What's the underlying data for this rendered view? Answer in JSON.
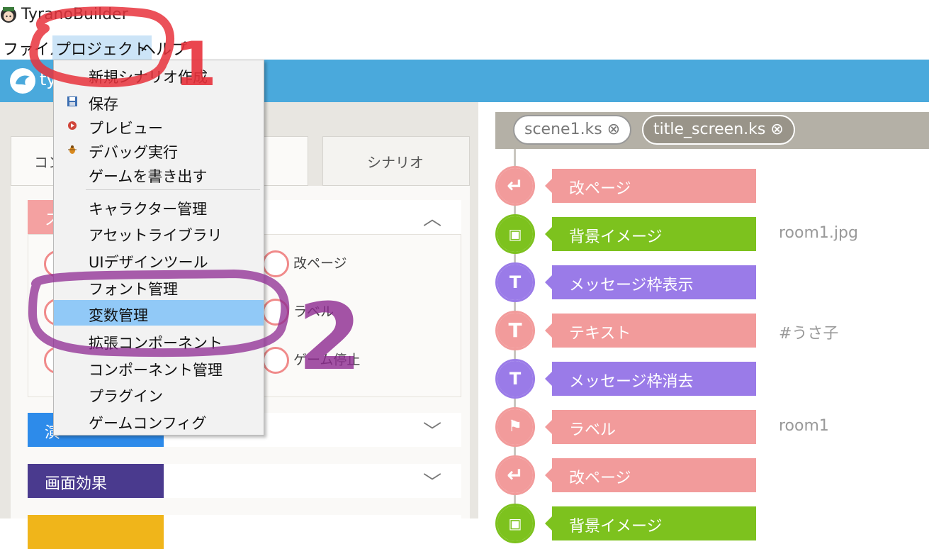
{
  "app": {
    "title": "TyranoBuilder",
    "logo_text": "ty"
  },
  "menubar": {
    "file": "ファイル",
    "project": "プロジェクト",
    "help": "ヘルプ"
  },
  "dropdown": {
    "items": [
      {
        "label": "新規シナリオ作成",
        "icon": ""
      },
      {
        "label": "保存",
        "icon": "floppy-icon"
      },
      {
        "label": "プレビュー",
        "icon": "play-icon"
      },
      {
        "label": "デバッグ実行",
        "icon": "bug-icon"
      },
      {
        "label": "ゲームを書き出す",
        "icon": ""
      },
      {
        "label": "キャラクター管理",
        "icon": ""
      },
      {
        "label": "アセットライブラリ",
        "icon": ""
      },
      {
        "label": "UIデザインツール",
        "icon": ""
      },
      {
        "label": "フォント管理",
        "icon": ""
      },
      {
        "label": "変数管理",
        "icon": "",
        "highlighted": true
      },
      {
        "label": "拡張コンポーネント",
        "icon": ""
      },
      {
        "label": "コンポーネント管理",
        "icon": ""
      },
      {
        "label": "プラグイン",
        "icon": ""
      },
      {
        "label": "ゲームコンフィグ",
        "icon": ""
      }
    ]
  },
  "left": {
    "tabs": [
      {
        "label": "コン"
      },
      {
        "label": "シナリオ"
      }
    ],
    "sections": [
      {
        "label": "ス",
        "color": "#f4a1a1"
      },
      {
        "label": "演",
        "color": "#2d8bea"
      },
      {
        "label": "画面効果",
        "color": "#4a3a8e"
      },
      {
        "label": "",
        "color": "#f0b51a"
      }
    ],
    "components": [
      {
        "label": "改ページ"
      },
      {
        "label": "ラベル"
      },
      {
        "label": "ゲーム停止"
      }
    ]
  },
  "right": {
    "file_tabs": [
      {
        "label": "scene1.ks"
      },
      {
        "label": "title_screen.ks"
      }
    ],
    "timeline": [
      {
        "label": "改ページ",
        "param": "",
        "color": "#f29b9b",
        "icon": "page-break-icon"
      },
      {
        "label": "背景イメージ",
        "param": "room1.jpg",
        "color": "#7dc21e",
        "icon": "background-image-icon"
      },
      {
        "label": "メッセージ枠表示",
        "param": "",
        "color": "#9a7be8",
        "icon": "show-message-icon"
      },
      {
        "label": "テキスト",
        "param": "#うさ子",
        "color": "#f29b9b",
        "icon": "text-icon"
      },
      {
        "label": "メッセージ枠消去",
        "param": "",
        "color": "#9a7be8",
        "icon": "hide-message-icon"
      },
      {
        "label": "ラベル",
        "param": "room1",
        "color": "#f29b9b",
        "icon": "label-flag-icon"
      },
      {
        "label": "改ページ",
        "param": "",
        "color": "#f29b9b",
        "icon": "page-break-icon"
      },
      {
        "label": "背景イメージ",
        "param": "",
        "color": "#7dc21e",
        "icon": "background-image-icon"
      }
    ]
  },
  "annotations": {
    "one": "1",
    "two": "2"
  }
}
